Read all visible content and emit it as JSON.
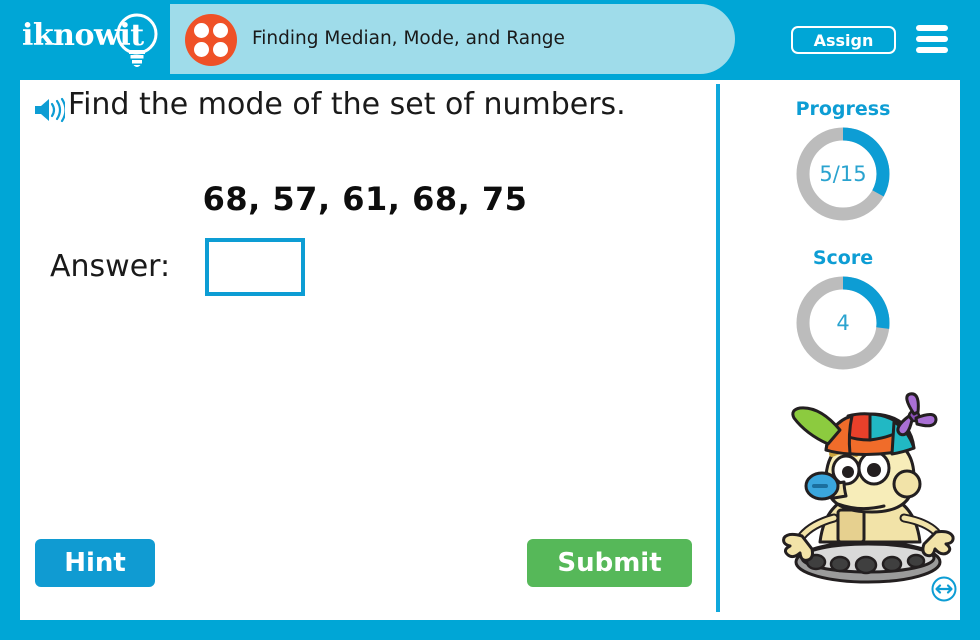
{
  "header": {
    "logo_text": "iknowit",
    "logo_icon": "lightbulb-icon",
    "lesson_icon": "four-dots-circle-icon",
    "lesson_title": "Finding Median, Mode, and Range",
    "assign_label": "Assign",
    "menu_icon": "hamburger-menu-icon"
  },
  "question": {
    "audio_icon": "speaker-icon",
    "prompt": "Find the mode of the set of numbers.",
    "number_set": "68, 57, 61, 68, 75",
    "answer_label": "Answer:",
    "answer_value": "",
    "answer_placeholder": ""
  },
  "actions": {
    "hint_label": "Hint",
    "submit_label": "Submit"
  },
  "sidebar": {
    "progress": {
      "title": "Progress",
      "value_text": "5/15",
      "current": 5,
      "total": 15,
      "percent": 33
    },
    "score": {
      "title": "Score",
      "value_text": "4",
      "current": 4,
      "percent": 27
    },
    "mascot": "robot-mascot-with-propeller-cap",
    "resize_icon": "resize-horizontal-icon"
  },
  "colors": {
    "frame_blue": "#00a6d6",
    "title_pill_blue": "#9fdcea",
    "accent_blue": "#0d9dd4",
    "orange": "#ef5127",
    "submit_green": "#56b859",
    "donut_track_gray": "#bcbcbc",
    "donut_fill_blue": "#0d9dd4"
  }
}
